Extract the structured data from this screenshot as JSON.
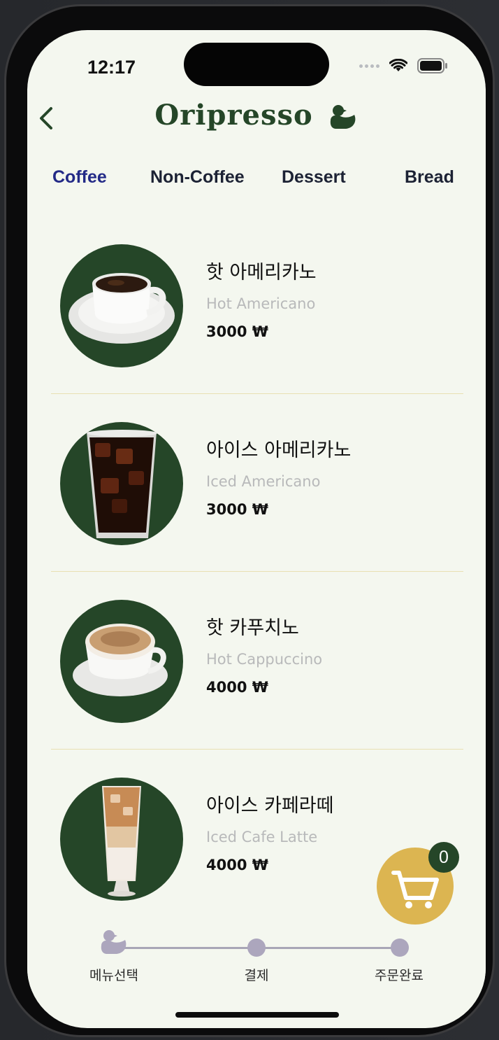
{
  "status_bar": {
    "time": "12:17"
  },
  "header": {
    "brand": "Oripresso"
  },
  "tabs": [
    {
      "label": "Coffee",
      "active": true
    },
    {
      "label": "Non-Coffee",
      "active": false
    },
    {
      "label": "Dessert",
      "active": false
    },
    {
      "label": "Bread",
      "active": false
    }
  ],
  "menu": [
    {
      "name_ko": "핫 아메리카노",
      "name_en": "Hot Americano",
      "price": "3000 ₩",
      "image": "hot-coffee-cup"
    },
    {
      "name_ko": "아이스 아메리카노",
      "name_en": "Iced Americano",
      "price": "3000 ₩",
      "image": "iced-coffee-glass"
    },
    {
      "name_ko": "핫 카푸치노",
      "name_en": "Hot Cappuccino",
      "price": "4000 ₩",
      "image": "cappuccino-cup"
    },
    {
      "name_ko": "아이스 카페라떼",
      "name_en": "Iced Cafe Latte",
      "price": "4000 ₩",
      "image": "iced-latte-glass"
    }
  ],
  "cart": {
    "count": "0"
  },
  "progress": {
    "steps": [
      "메뉴선택",
      "결제",
      "주문완료"
    ],
    "current": 0
  },
  "colors": {
    "background": "#f4f7ef",
    "brand_green": "#254628",
    "active_tab": "#232a87",
    "cart_gold": "#dcb551",
    "step_inactive": "#aca6bd"
  }
}
